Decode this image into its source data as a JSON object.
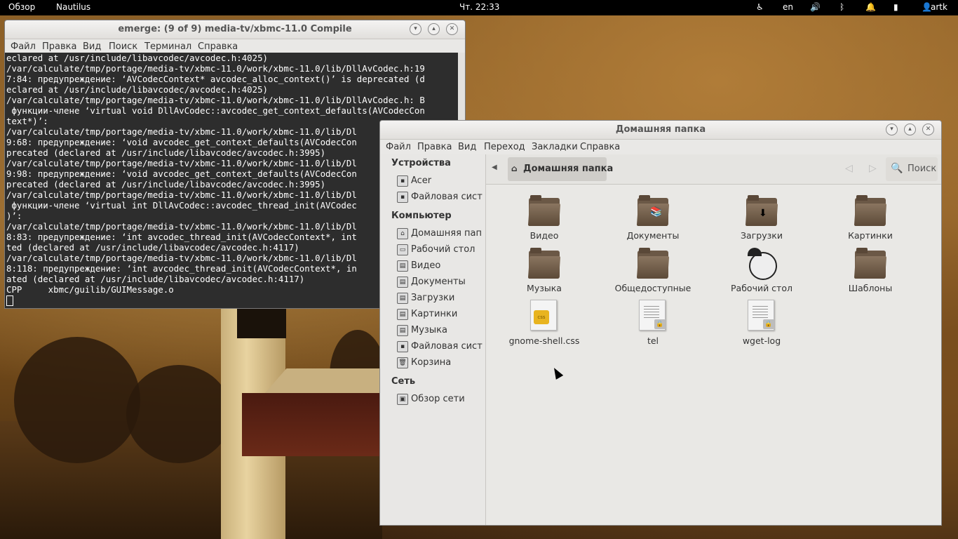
{
  "topbar": {
    "activities": "Обзор",
    "app": "Nautilus",
    "clock": "Чт. 22:33",
    "lang": "en",
    "user": "artk",
    "icons": [
      "accessibility-icon",
      "volume-icon",
      "bluetooth-icon",
      "notification-icon",
      "battery-icon",
      "user-icon"
    ]
  },
  "terminal": {
    "title": "emerge: (9 of 9) media-tv/xbmc-11.0 Compile",
    "menu": [
      "Файл",
      "Правка",
      "Вид",
      "Поиск",
      "Терминал",
      "Справка"
    ],
    "lines": [
      "eclared at /usr/include/libavcodec/avcodec.h:4025)",
      "/var/calculate/tmp/portage/media-tv/xbmc-11.0/work/xbmc-11.0/lib/DllAvCodec.h:19",
      "7:84: предупреждение: ‘AVCodecContext* avcodec_alloc_context()’ is deprecated (d",
      "eclared at /usr/include/libavcodec/avcodec.h:4025)",
      "/var/calculate/tmp/portage/media-tv/xbmc-11.0/work/xbmc-11.0/lib/DllAvCodec.h: В",
      " функции-члене ‘virtual void DllAvCodec::avcodec_get_context_defaults(AVCodecCon",
      "text*)’:",
      "/var/calculate/tmp/portage/media-tv/xbmc-11.0/work/xbmc-11.0/lib/Dl",
      "9:68: предупреждение: ‘void avcodec_get_context_defaults(AVCodecCon",
      "precated (declared at /usr/include/libavcodec/avcodec.h:3995)",
      "/var/calculate/tmp/portage/media-tv/xbmc-11.0/work/xbmc-11.0/lib/Dl",
      "9:98: предупреждение: ‘void avcodec_get_context_defaults(AVCodecCon",
      "precated (declared at /usr/include/libavcodec/avcodec.h:3995)",
      "/var/calculate/tmp/portage/media-tv/xbmc-11.0/work/xbmc-11.0/lib/Dl",
      " функции-члене ‘virtual int DllAvCodec::avcodec_thread_init(AVCodec",
      ")’:",
      "/var/calculate/tmp/portage/media-tv/xbmc-11.0/work/xbmc-11.0/lib/Dl",
      "8:83: предупреждение: ‘int avcodec_thread_init(AVCodecContext*, int",
      "ted (declared at /usr/include/libavcodec/avcodec.h:4117)",
      "/var/calculate/tmp/portage/media-tv/xbmc-11.0/work/xbmc-11.0/lib/Dl",
      "8:118: предупреждение: ‘int avcodec_thread_init(AVCodecContext*, in",
      "ated (declared at /usr/include/libavcodec/avcodec.h:4117)",
      "CPP     xbmc/guilib/GUIMessage.o"
    ]
  },
  "nautilus": {
    "title": "Домашняя папка",
    "menu": [
      "Файл",
      "Правка",
      "Вид",
      "Переход",
      "Закладки",
      "Справка"
    ],
    "sidebar": {
      "devices_heading": "Устройства",
      "devices": [
        "Acer",
        "Файловая сист..."
      ],
      "computer_heading": "Компьютер",
      "computer": [
        "Домашняя пап...",
        "Рабочий стол",
        "Видео",
        "Документы",
        "Загрузки",
        "Картинки",
        "Музыка",
        "Файловая сист...",
        "Корзина"
      ],
      "network_heading": "Сеть",
      "network": [
        "Обзор сети"
      ]
    },
    "breadcrumb": "Домашняя папка",
    "search_label": "Поиск",
    "files": [
      "Видео",
      "Документы",
      "Загрузки",
      "Картинки",
      "Музыка",
      "Общедоступные",
      "Рабочий стол",
      "Шаблоны",
      "gnome-shell.css",
      "tel",
      "wget-log"
    ]
  }
}
